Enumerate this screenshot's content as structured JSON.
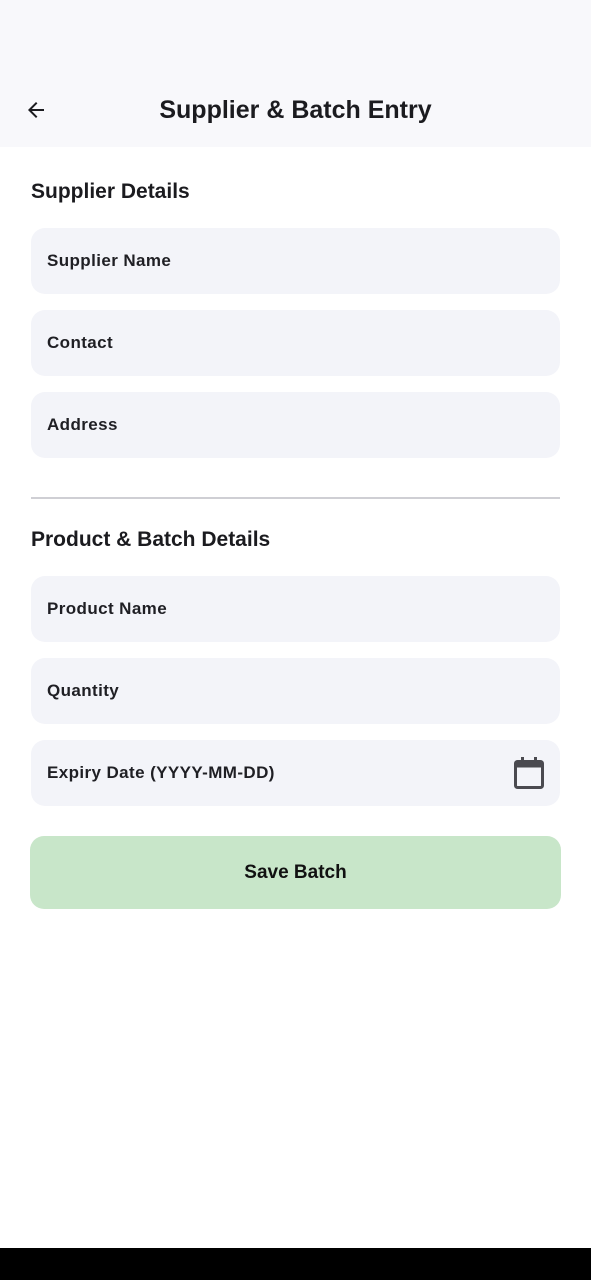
{
  "header": {
    "title": "Supplier & Batch Entry",
    "back_icon": "arrow-back-icon"
  },
  "supplier": {
    "section_title": "Supplier Details",
    "fields": {
      "name": {
        "label": "Supplier Name",
        "value": ""
      },
      "contact": {
        "label": "Contact",
        "value": ""
      },
      "address": {
        "label": "Address",
        "value": ""
      }
    }
  },
  "product": {
    "section_title": "Product & Batch Details",
    "fields": {
      "name": {
        "label": "Product Name",
        "value": ""
      },
      "quantity": {
        "label": "Quantity",
        "value": ""
      },
      "expiry": {
        "label": "Expiry Date (YYYY-MM-DD)",
        "value": "",
        "icon": "calendar-icon"
      }
    }
  },
  "actions": {
    "save_label": "Save Batch"
  },
  "colors": {
    "app_bar_bg": "#f8f8fb",
    "field_bg": "#f3f4f9",
    "save_button_bg": "#c8e6c9",
    "text": "#1b1b1f"
  }
}
